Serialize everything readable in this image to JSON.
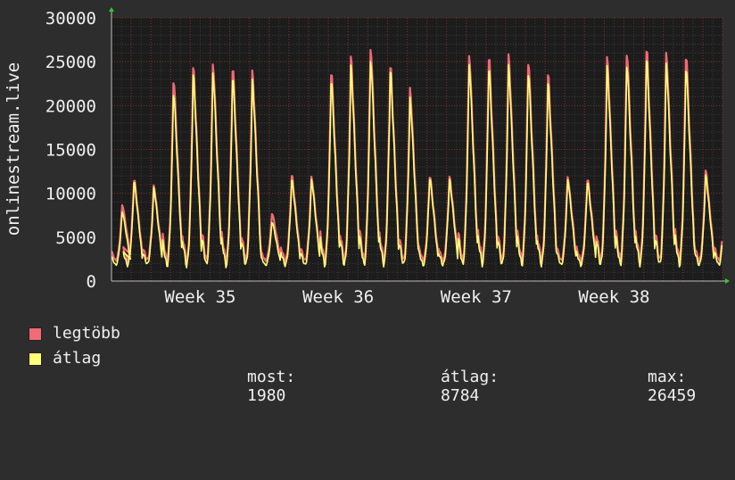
{
  "chart_data": {
    "type": "line",
    "ylabel": "onlinestream.live",
    "ylim": [
      0,
      30000
    ],
    "yticks": [
      0,
      5000,
      10000,
      15000,
      20000,
      25000,
      30000
    ],
    "xticks": [
      "Week 35",
      "Week 36",
      "Week 37",
      "Week 38"
    ],
    "xlim": [
      0,
      31
    ],
    "grid": true,
    "series": [
      {
        "name": "legtöbb",
        "color": "#f06b73",
        "x": [
          0,
          0.6,
          1.6,
          2.6,
          3.6,
          4.6,
          5.6,
          6.6,
          7.6,
          8.6,
          9.6,
          10.6,
          11.6,
          12.6,
          13.6,
          14.6,
          15.6,
          16.6,
          17.6,
          18.6,
          19.6,
          20.6,
          21.6,
          22.6,
          23.6,
          24.6,
          25.6,
          26.6,
          27.6,
          28.6,
          29.6,
          30.6
        ],
        "peaks": [
          9000,
          12000,
          11200,
          24000,
          25300,
          25800,
          25400,
          24800,
          8000,
          12500,
          12300,
          25000,
          26500,
          27800,
          25600,
          22800,
          12500,
          12300,
          26900,
          26700,
          26700,
          26200,
          24500,
          12300,
          12100,
          26400,
          27200,
          27500,
          27000,
          26900,
          13000,
          12400
        ],
        "dips": [
          2300,
          2300,
          2400,
          2200,
          2200,
          2300,
          2200,
          2300,
          2300,
          2300,
          2300,
          2300,
          2300,
          2300,
          2300,
          2300,
          2300,
          2300,
          2300,
          2300,
          2300,
          2300,
          2300,
          2300,
          2300,
          2300,
          2300,
          2300,
          2300,
          2300,
          2300,
          2300
        ]
      },
      {
        "name": "átlag",
        "color": "#ffff78",
        "x": [
          0,
          0.6,
          1.6,
          2.6,
          3.6,
          4.6,
          5.6,
          6.6,
          7.6,
          8.6,
          9.6,
          10.6,
          11.6,
          12.6,
          13.6,
          14.6,
          15.6,
          16.6,
          17.6,
          18.6,
          19.6,
          20.6,
          21.6,
          22.6,
          23.6,
          24.6,
          25.6,
          26.6,
          27.6,
          28.6,
          29.6,
          30.6
        ],
        "peaks": [
          8200,
          11800,
          11000,
          22500,
          24500,
          24800,
          24300,
          23800,
          7000,
          12000,
          12000,
          24000,
          25500,
          26400,
          25100,
          21700,
          12300,
          12000,
          25900,
          25400,
          25500,
          24900,
          23500,
          12000,
          11800,
          25400,
          25800,
          26400,
          25800,
          25500,
          12500,
          12000
        ],
        "dips": [
          1800,
          1800,
          1900,
          1700,
          1700,
          1800,
          1700,
          1800,
          1800,
          1800,
          1800,
          1800,
          1800,
          1800,
          1800,
          1800,
          1800,
          1800,
          1800,
          1800,
          1800,
          1800,
          1800,
          1800,
          1800,
          1800,
          1800,
          1800,
          1800,
          1800,
          1800,
          1800
        ]
      }
    ]
  },
  "legend": {
    "max_label": "legtöbb",
    "avg_label": "átlag",
    "max_color": "#f06b73",
    "avg_color": "#ffff78",
    "most_label": "most:",
    "most_value": "1980",
    "avg_stat_label": "átlag:",
    "avg_stat_value": "8784",
    "max_stat_label": "max:",
    "max_stat_value": "26459"
  }
}
